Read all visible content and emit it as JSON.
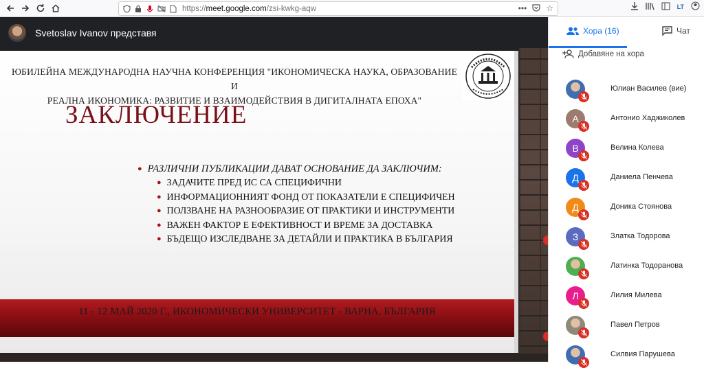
{
  "browser": {
    "url_prefix": "https://",
    "url_host": "meet.google.com",
    "url_path": "/zsi-kwkg-aqw",
    "icons": [
      "back-icon",
      "forward-icon",
      "reload-icon",
      "home-icon",
      "shield-icon",
      "lock-icon",
      "mic-icon",
      "camera-off-icon",
      "page-icon",
      "more-icon",
      "pocket-icon",
      "bookmark-star-icon",
      "download-icon",
      "library-icon",
      "sidebar-icon",
      "extension-icon",
      "account-icon"
    ],
    "extension_label": "LT"
  },
  "meet": {
    "presenter_label": "Svetoslav Ivanov представя"
  },
  "slide": {
    "heading_line1": "ЮБИЛЕЙНА МЕЖДУНАРОДНА НАУЧНА КОНФЕРЕНЦИЯ \"ИКОНОМИЧЕСКА НАУКА, ОБРАЗОВАНИЕ И",
    "heading_line2": "РЕАЛНА ИКОНОМИКА: РАЗВИТИЕ И ВЗАИМОДЕЙСТВИЯ  В ДИГИТАЛНАТА ЕПОХА\"",
    "title": "ЗАКЛЮЧЕНИЕ",
    "bullet_main": "РАЗЛИЧНИ ПУБЛИКАЦИИ ДАВАТ ОСНОВАНИЕ ДА ЗАКЛЮЧИМ:",
    "sub_bullets": [
      "ЗАДАЧИТЕ ПРЕД ИС СА СПЕЦИФИЧНИ",
      "ИНФОРМАЦИОННИЯТ ФОНД ОТ ПОКАЗАТЕЛИ Е СПЕЦИФИЧЕН",
      "ПОЛЗВАНЕ НА РАЗНООБРАЗИЕ ОТ ПРАКТИКИ И ИНСТРУМЕНТИ",
      "ВАЖЕН ФАКТОР Е ЕФЕКТИВНОСТ И ВРЕМЕ ЗА ДОСТАВКА",
      "БЪДЕЩО ИЗСЛЕДВАНЕ ЗА ДЕТАЙЛИ И ПРАКТИКА В БЪЛГАРИЯ"
    ],
    "footer": "11 - 12 МАЙ 2020 Г., ИКОНОМИЧЕСКИ УНИВЕРСИТЕТ - ВАРНА, БЪЛГАРИЯ",
    "accent_color": "#7a1018"
  },
  "panel": {
    "people_tab": "Хора (16)",
    "chat_tab": "Чат",
    "add_people": "Добавяне на хора",
    "accent_color": "#1a73e8",
    "people": [
      {
        "name": "Юлиан Василев (вие)",
        "initial": "",
        "color": "#3f6fb0",
        "photo": true,
        "muted": true
      },
      {
        "name": "Антонио Хаджиколев",
        "initial": "А",
        "color": "#9e7b6f",
        "photo": false,
        "muted": true
      },
      {
        "name": "Велина Колева",
        "initial": "В",
        "color": "#8e44c9",
        "photo": false,
        "muted": true
      },
      {
        "name": "Даниела Пенчева",
        "initial": "Д",
        "color": "#1a73e8",
        "photo": false,
        "muted": true
      },
      {
        "name": "Доника Стоянова",
        "initial": "Д",
        "color": "#f08b1a",
        "photo": false,
        "muted": true
      },
      {
        "name": "Златка Тодорова",
        "initial": "З",
        "color": "#5c6bc0",
        "photo": false,
        "muted": true
      },
      {
        "name": "Латинка Тодоранова",
        "initial": "",
        "color": "#4caf50",
        "photo": true,
        "muted": true
      },
      {
        "name": "Лилия Милева",
        "initial": "Л",
        "color": "#e91e8c",
        "photo": false,
        "muted": true
      },
      {
        "name": "Павел Петров",
        "initial": "",
        "color": "#8d8a7a",
        "photo": true,
        "muted": true
      },
      {
        "name": "Силвия Парушева",
        "initial": "",
        "color": "#3d6db3",
        "photo": true,
        "muted": true
      }
    ]
  }
}
